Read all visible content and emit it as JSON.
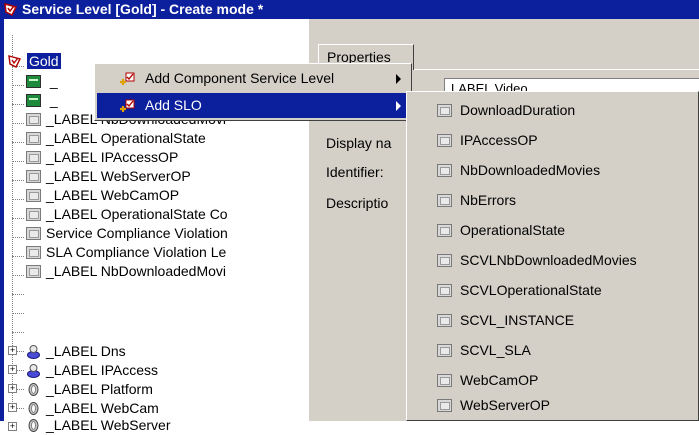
{
  "window": {
    "title": "Service Level [Gold] - Create mode *"
  },
  "tree": {
    "root": "Gold",
    "hidden_child_1": "_",
    "hidden_child_2": "_",
    "items": [
      "_LABEL NbDownloadedMovi",
      "_LABEL OperationalState",
      "_LABEL IPAccessOP",
      "_LABEL WebServerOP",
      "_LABEL WebCamOP",
      "_LABEL OperationalState Co",
      "Service Compliance Violation",
      "SLA Compliance Violation Le",
      "_LABEL NbDownloadedMovi"
    ],
    "services": [
      "_LABEL Dns",
      "_LABEL IPAccess",
      "_LABEL Platform",
      "_LABEL WebCam",
      "_LABEL WebServer"
    ]
  },
  "properties": {
    "tab_label": "Properties",
    "display_name_label": "Display na",
    "identifier_label": "Identifier:",
    "description_label": "Descriptio",
    "field_value": "LABEL Video"
  },
  "context_menu": {
    "items": [
      {
        "label": "Add Component Service Level"
      },
      {
        "label": "Add SLO"
      }
    ]
  },
  "submenu": {
    "items": [
      "DownloadDuration",
      "IPAccessOP",
      "NbDownloadedMovies",
      "NbErrors",
      "OperationalState",
      "SCVLNbDownloadedMovies",
      "SCVLOperationalState",
      "SCVL_INSTANCE",
      "SCVL_SLA",
      "WebCamOP",
      "WebServerOP"
    ]
  },
  "colors": {
    "title_bar": "#0c1f9c",
    "selection": "#0c1f9c",
    "panel": "#d4d0c8"
  }
}
